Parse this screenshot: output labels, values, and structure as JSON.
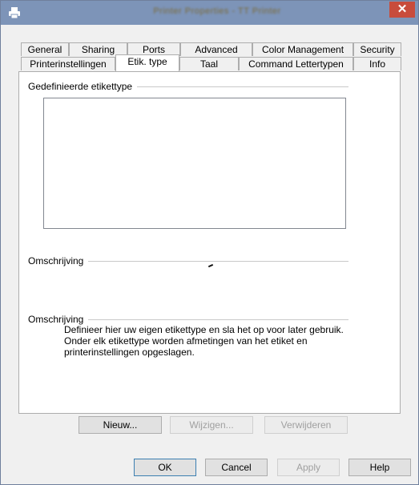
{
  "window": {
    "title": "Printer Properties - TT Printer"
  },
  "tabs_row1": [
    "General",
    "Sharing",
    "Ports",
    "Advanced",
    "Color Management",
    "Security"
  ],
  "tabs_row2": [
    "Printerinstellingen",
    "Etik. type",
    "Taal",
    "Command Lettertypen",
    "Info"
  ],
  "active_tab": "Etik. type",
  "groups": {
    "defined_label_types": "Gedefinieerde etikettype",
    "description1": "Omschrijving",
    "description2": "Omschrijving"
  },
  "description_lines": [
    "Definieer hier uw eigen etikettype en sla het op voor later gebruik.",
    "Onder elk etikettype worden afmetingen van het etiket en",
    "printerinstellingen opgeslagen."
  ],
  "buttons": {
    "new": "Nieuw...",
    "edit": "Wijzigen...",
    "delete": "Verwijderen"
  },
  "footer": {
    "ok": "OK",
    "cancel": "Cancel",
    "apply": "Apply",
    "help": "Help"
  }
}
